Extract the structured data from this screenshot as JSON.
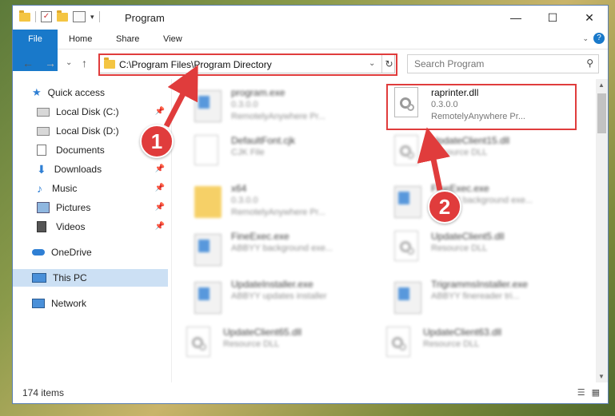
{
  "window": {
    "title": "Program"
  },
  "controls": {
    "minimize": "—",
    "maximize": "☐",
    "close": "✕"
  },
  "ribbon": {
    "tabs": [
      "File",
      "Home",
      "Share",
      "View"
    ],
    "help": "?"
  },
  "address": {
    "path": "C:\\Program Files\\Program Directory"
  },
  "search": {
    "placeholder": "Search Program"
  },
  "nav": {
    "items": [
      {
        "label": "Quick access",
        "icon": "star-icon",
        "pinned": false
      },
      {
        "label": "Local Disk (C:)",
        "icon": "drive-icon",
        "pinned": true
      },
      {
        "label": "Local Disk (D:)",
        "icon": "drive-icon",
        "pinned": true
      },
      {
        "label": "Documents",
        "icon": "documents-icon",
        "pinned": false
      },
      {
        "label": "Downloads",
        "icon": "download-icon",
        "pinned": true
      },
      {
        "label": "Music",
        "icon": "music-icon",
        "pinned": true
      },
      {
        "label": "Pictures",
        "icon": "pictures-icon",
        "pinned": true
      },
      {
        "label": "Videos",
        "icon": "videos-icon",
        "pinned": true
      },
      {
        "label": "OneDrive",
        "icon": "cloud-icon",
        "pinned": false
      },
      {
        "label": "This PC",
        "icon": "computer-icon",
        "pinned": false,
        "selected": true
      },
      {
        "label": "Network",
        "icon": "network-icon",
        "pinned": false
      }
    ]
  },
  "files": [
    {
      "name": "program.exe",
      "line2": "0.3.0.0",
      "line3": "RemotelyAnywhere Pr...",
      "type": "exe"
    },
    {
      "name": "raprinter.dll",
      "line2": "0.3.0.0",
      "line3": "RemotelyAnywhere Pr...",
      "type": "dll",
      "highlighted": true
    },
    {
      "name": "DefaultFont.cjk",
      "line2": "CJK File",
      "line3": "",
      "type": "doc"
    },
    {
      "name": "UpdateClient15.dll",
      "line2": "Resource DLL",
      "line3": "",
      "type": "dll"
    },
    {
      "name": "x64",
      "line2": "0.3.0.0",
      "line3": "RemotelyAnywhere Pr...",
      "type": "folder"
    },
    {
      "name": "FineExec.exe",
      "line2": "ABBYY background exe...",
      "line3": "",
      "type": "exe"
    },
    {
      "name": "FineExec.exe",
      "line2": "ABBYY background exe...",
      "line3": "",
      "type": "exe"
    },
    {
      "name": "UpdateClient5.dll",
      "line2": "Resource DLL",
      "line3": "",
      "type": "dll"
    },
    {
      "name": "UpdateInstaller.exe",
      "line2": "ABBYY updates installer",
      "line3": "",
      "type": "exe"
    },
    {
      "name": "TrigrammsInstaller.exe",
      "line2": "ABBYY finereader tri...",
      "line3": "",
      "type": "exe"
    },
    {
      "name": "UpdateClient65.dll",
      "line2": "Resource DLL",
      "line3": "",
      "type": "dll"
    },
    {
      "name": "UpdateClient63.dll",
      "line2": "Resource DLL",
      "line3": "",
      "type": "dll"
    }
  ],
  "status": {
    "count": "174 items"
  },
  "annotations": {
    "badge1": "1",
    "badge2": "2",
    "color": "#e03c3c"
  }
}
